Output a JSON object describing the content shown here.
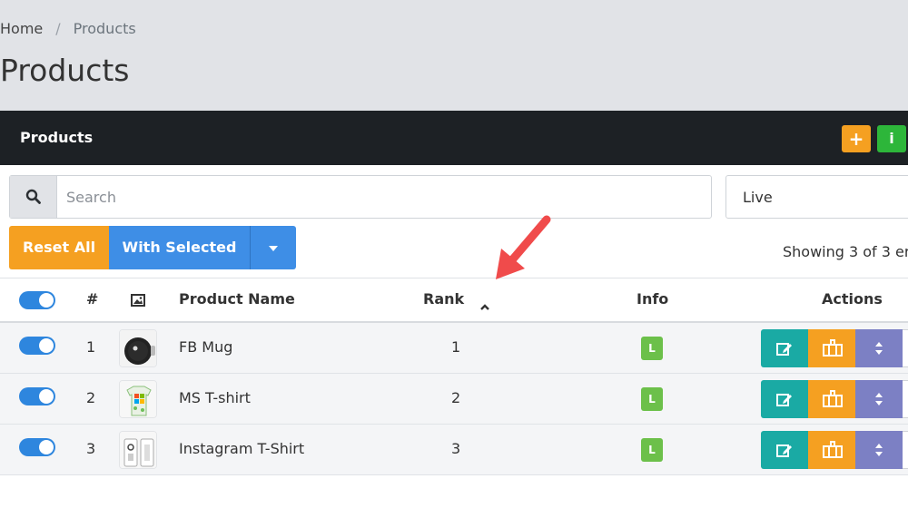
{
  "breadcrumb": {
    "home": "Home",
    "separator": "/",
    "current": "Products"
  },
  "page_title": "Products",
  "panel": {
    "title": "Products",
    "add_button": "+",
    "info_button": "i"
  },
  "search": {
    "placeholder": "Search",
    "value": ""
  },
  "status_filter": {
    "selected": "Live"
  },
  "bulk": {
    "reset_all": "Reset All",
    "with_selected": "With Selected"
  },
  "showing_text": "Showing 3 of 3 er",
  "table": {
    "headers": {
      "num": "#",
      "product_name": "Product Name",
      "rank": "Rank",
      "info": "Info",
      "actions": "Actions"
    },
    "sort": {
      "column": "Rank",
      "direction": "ascending"
    },
    "rows": [
      {
        "num": "1",
        "name": "FB Mug",
        "rank": "1",
        "info_badge": "L",
        "enabled": true
      },
      {
        "num": "2",
        "name": "MS T-shirt",
        "rank": "2",
        "info_badge": "L",
        "enabled": true
      },
      {
        "num": "3",
        "name": "Instagram T-Shirt",
        "rank": "3",
        "info_badge": "L",
        "enabled": true
      }
    ]
  },
  "colors": {
    "header_dark": "#1d2125",
    "orange": "#f5a021",
    "blue": "#3e8ee6",
    "green": "#2db63a",
    "teal": "#1aaaa4",
    "purple": "#7c80c4",
    "toggle_on": "#2e86de",
    "annotation_arrow": "#f04b4b"
  }
}
